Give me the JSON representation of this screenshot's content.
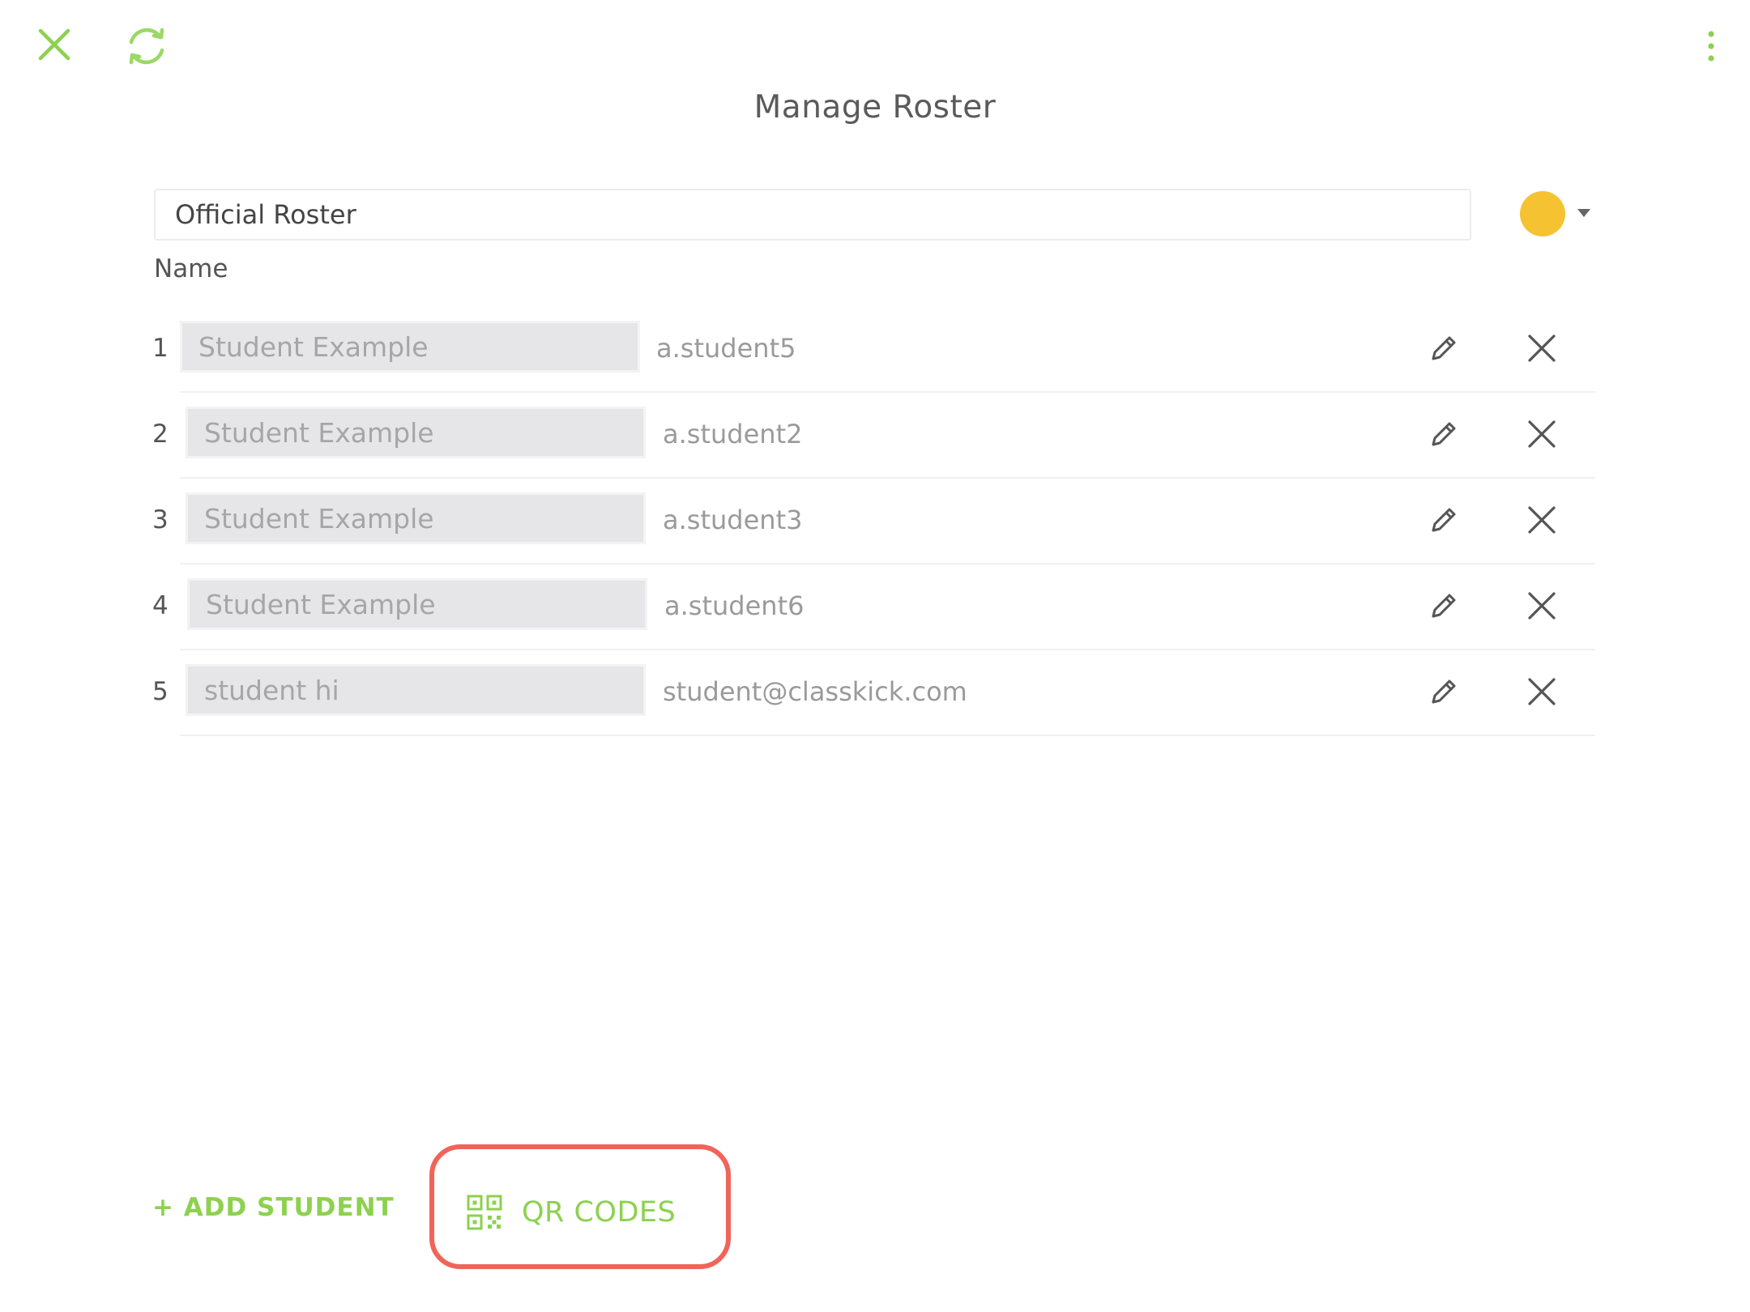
{
  "header": {
    "title": "Manage Roster",
    "close_icon": "close-icon",
    "sync_icon": "sync-icon",
    "more_icon": "more-vertical-icon"
  },
  "roster": {
    "name_value": "Official Roster",
    "color": "#f5c331",
    "column_header": "Name"
  },
  "students": [
    {
      "number": "1",
      "name": "Student Example",
      "username": "a.student5"
    },
    {
      "number": "2",
      "name": "Student Example",
      "username": "a.student2"
    },
    {
      "number": "3",
      "name": "Student Example",
      "username": "a.student3"
    },
    {
      "number": "4",
      "name": "Student Example",
      "username": "a.student6"
    },
    {
      "number": "5",
      "name": "student hi",
      "username": "student@classkick.com"
    }
  ],
  "footer": {
    "add_student_label": "+ ADD STUDENT",
    "qr_codes_label": "QR CODES",
    "qr_icon": "qr-code-icon"
  },
  "colors": {
    "accent_green": "#8dd14f",
    "highlight_red": "#f0645a"
  }
}
